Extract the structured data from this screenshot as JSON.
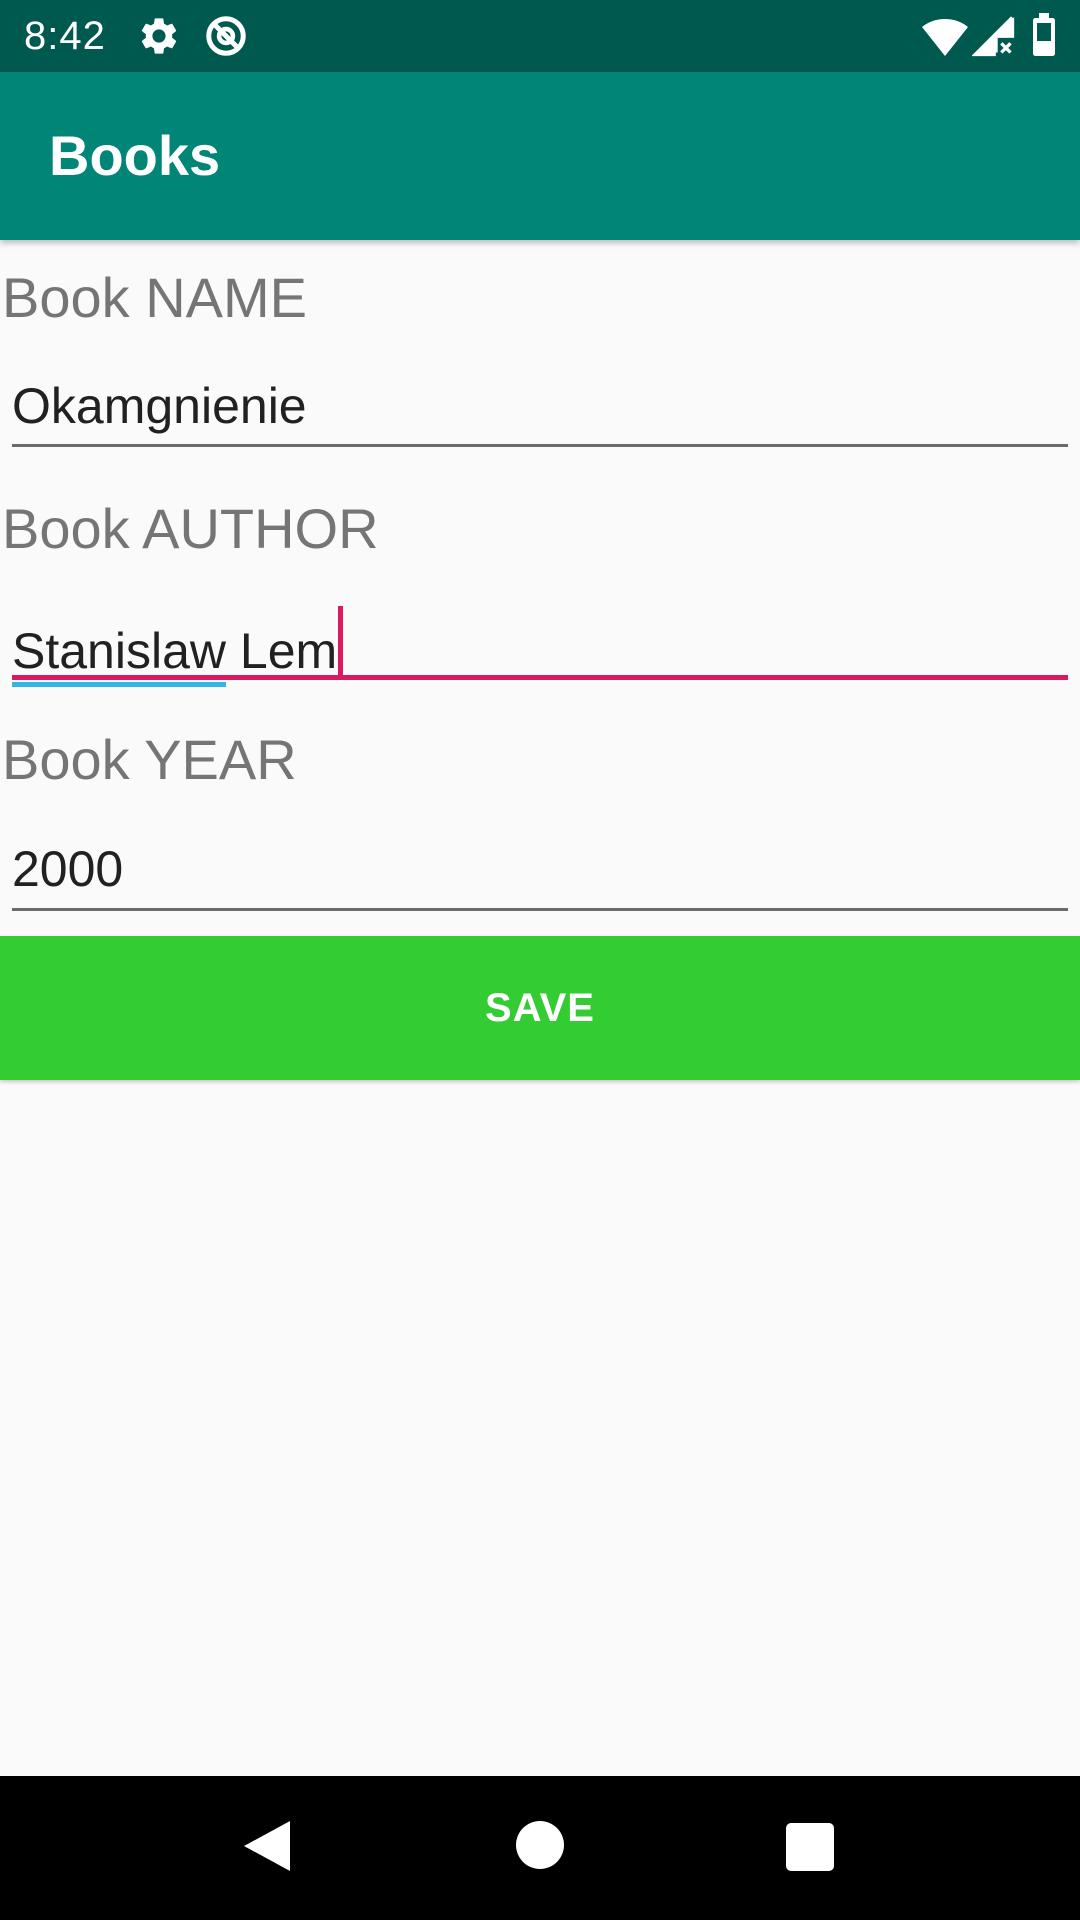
{
  "status_bar": {
    "time": "8:42",
    "icons": [
      "gear-icon",
      "no-proxy-icon",
      "wifi-icon",
      "signal-icon",
      "battery-icon"
    ]
  },
  "app_bar": {
    "title": "Books"
  },
  "form": {
    "name_label": "Book NAME",
    "name_value": "Okamgnienie",
    "author_label": "Book AUTHOR",
    "author_value_word1": "Stanislaw",
    "author_value_rest": " Lem",
    "year_label": "Book YEAR",
    "year_value": "2000",
    "save_label": "SAVE"
  },
  "nav_bar": {
    "icons": [
      "back-icon",
      "home-icon",
      "recents-icon"
    ]
  },
  "colors": {
    "status_bar": "#00594f",
    "app_bar": "#008577",
    "accent": "#d81b60",
    "save_button": "#33cc33",
    "spellcheck": "#33b5e5"
  }
}
